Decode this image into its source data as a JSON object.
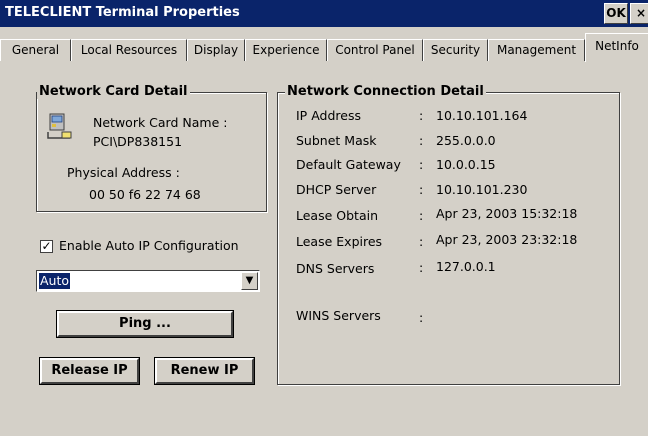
{
  "window": {
    "title": "TELECLIENT Terminal Properties",
    "ok_label": "OK",
    "close_label": "×"
  },
  "tabs": [
    {
      "label": "General"
    },
    {
      "label": "Local Resources"
    },
    {
      "label": "Display"
    },
    {
      "label": "Experience"
    },
    {
      "label": "Control Panel"
    },
    {
      "label": "Security"
    },
    {
      "label": "Management"
    },
    {
      "label": "NetInfo",
      "active": true
    }
  ],
  "network_card": {
    "legend": "Network Card Detail",
    "name_label": "Network Card Name :",
    "name_value": "PCI\\DP838151",
    "physical_label": "Physical Address :",
    "physical_value": "00 50 f6 22 74 68",
    "icon": "network-card-icon"
  },
  "auto_ip": {
    "label": "Enable Auto IP Configuration",
    "checked": true,
    "check_glyph": "✓",
    "combo_value": "Auto",
    "combo_arrow": "▼"
  },
  "buttons": {
    "ping": "Ping ...",
    "release": "Release IP",
    "renew": "Renew IP"
  },
  "connection": {
    "legend": "Network Connection Detail",
    "rows": [
      {
        "label": "IP Address",
        "sep": ":",
        "value": "10.10.101.164"
      },
      {
        "label": "Subnet Mask",
        "sep": ":",
        "value": "255.0.0.0"
      },
      {
        "label": "Default Gateway",
        "sep": ":",
        "value": "10.0.0.15"
      },
      {
        "label": "DHCP Server",
        "sep": ":",
        "value": "10.10.101.230"
      },
      {
        "label": "Lease Obtain",
        "sep": ":",
        "value": "Apr 23, 2003 15:32:18"
      },
      {
        "label": "Lease Expires",
        "sep": ":",
        "value": "Apr 23, 2003 23:32:18"
      },
      {
        "label": "DNS Servers",
        "sep": ":",
        "value": "127.0.0.1"
      },
      {
        "label": "WINS Servers",
        "sep": ":",
        "value": ""
      }
    ]
  },
  "colors": {
    "titlebar": "#0a246a",
    "face": "#d4d0c8",
    "selection": "#0a246a"
  }
}
